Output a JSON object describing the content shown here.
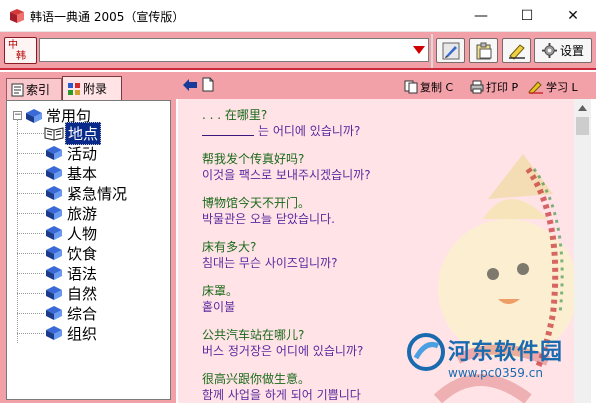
{
  "window": {
    "title": "韩语一典通 2005（宣传版）",
    "minimize_glyph": "—",
    "maximize_glyph": "☐",
    "close_glyph": "✕"
  },
  "toolbar": {
    "lang_line1": "中",
    "lang_line2": "韩",
    "search_value": "",
    "settings_label": "设置"
  },
  "left_panel": {
    "tab_index": "索引",
    "tab_appendix": "附录",
    "tree": {
      "root": "常用句",
      "items": [
        {
          "label": "地点",
          "selected": true
        },
        {
          "label": "活动",
          "selected": false
        },
        {
          "label": "基本",
          "selected": false
        },
        {
          "label": "紧急情况",
          "selected": false
        },
        {
          "label": "旅游",
          "selected": false
        },
        {
          "label": "人物",
          "selected": false
        },
        {
          "label": "饮食",
          "selected": false
        },
        {
          "label": "语法",
          "selected": false
        },
        {
          "label": "自然",
          "selected": false
        },
        {
          "label": "综合",
          "selected": false
        },
        {
          "label": "组织",
          "selected": false
        }
      ]
    }
  },
  "right_panel": {
    "copy_label": "复制 C",
    "print_label": "打印 P",
    "study_label": "学习 L",
    "phrases": [
      {
        "zh": ". . . 在哪里?",
        "ko": "는 어디에 있습니까?",
        "blank": true
      },
      {
        "zh": "帮我发个传真好吗?",
        "ko": "이것을 팩스로 보내주시겠습니까?",
        "blank": false
      },
      {
        "zh": "博物馆今天不开门。",
        "ko": "박물관은 오늘 닫았습니다.",
        "blank": false
      },
      {
        "zh": "床有多大?",
        "ko": "침대는 무슨 사이즈입니까?",
        "blank": false
      },
      {
        "zh": "床罩。",
        "ko": "홑이불",
        "blank": false
      },
      {
        "zh": "公共汽车站在哪儿?",
        "ko": "버스 정거장은 어디에 있습니까?",
        "blank": false
      },
      {
        "zh": "很高兴跟你做生意。",
        "ko": "함께 사업을 하게 되어 기쁩니다",
        "blank": false
      }
    ]
  },
  "watermark": {
    "title": "河东软件园",
    "url": "www.pc0359.cn"
  },
  "colors": {
    "panel_pink": "#f3a1a9",
    "content_bg": "#ffe3e6",
    "chinese_text": "#1a6a1a",
    "korean_text": "#5a2aa0",
    "selection": "#0a2a8a",
    "toolbar_border": "#cc2a3a",
    "watermark_blue": "#1a6ab0"
  },
  "icons": [
    "app-book-icon",
    "dropdown-arrow-icon",
    "edit-pencil-icon",
    "clipboard-icon",
    "notepad-icon",
    "gear-icon",
    "index-page-icon",
    "appendix-grid-icon",
    "book-icon",
    "open-book-icon",
    "back-arrow-icon",
    "page-icon",
    "copy-icon",
    "print-icon",
    "study-icon",
    "scroll-up-icon",
    "watermark-logo-icon"
  ]
}
